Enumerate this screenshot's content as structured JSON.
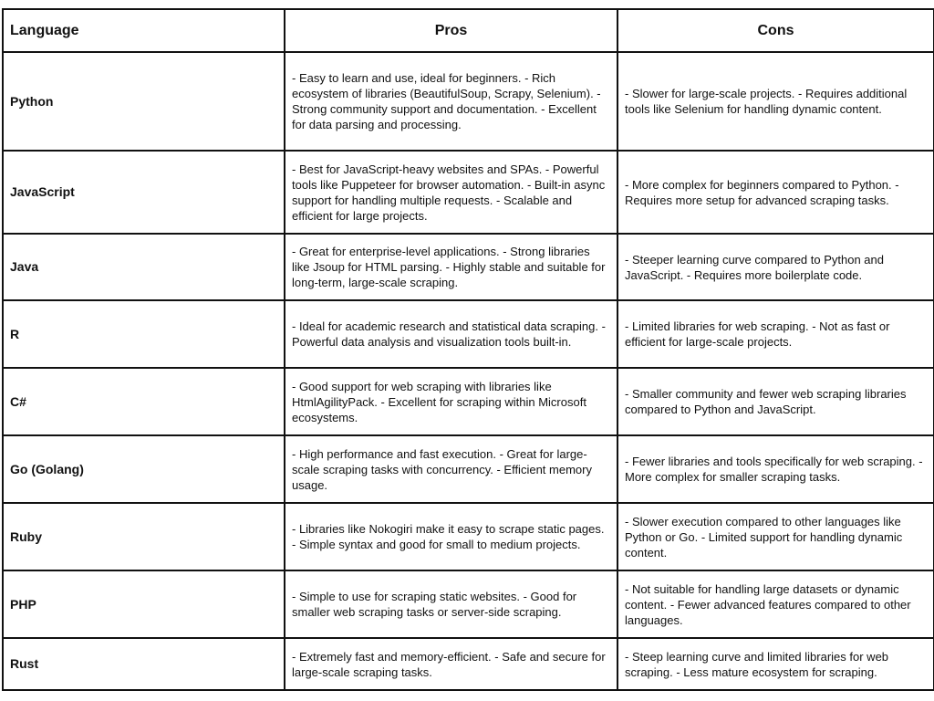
{
  "table": {
    "headers": {
      "language": "Language",
      "pros": "Pros",
      "cons": "Cons"
    },
    "rows": [
      {
        "language": "Python",
        "pros": "- Easy to learn and use, ideal for beginners.  - Rich ecosystem of libraries (BeautifulSoup, Scrapy, Selenium).  - Strong community support and documentation.  - Excellent for data parsing and processing.",
        "cons": "- Slower for large-scale projects.  - Requires additional tools like Selenium for handling dynamic content."
      },
      {
        "language": "JavaScript",
        "pros": "- Best for JavaScript-heavy websites and SPAs.  - Powerful tools like Puppeteer for browser automation.  - Built-in async support for handling multiple requests.  - Scalable and efficient for large projects.",
        "cons": "- More complex for beginners compared to Python.  - Requires more setup for advanced scraping tasks."
      },
      {
        "language": "Java",
        "pros": "- Great for enterprise-level applications.  - Strong libraries like Jsoup for HTML parsing.  - Highly stable and suitable for long-term, large-scale scraping.",
        "cons": "- Steeper learning curve compared to Python and JavaScript.  - Requires more boilerplate code."
      },
      {
        "language": "R",
        "pros": "- Ideal for academic research and statistical data scraping.  - Powerful data analysis and visualization tools built-in.",
        "cons": "- Limited libraries for web scraping.  - Not as fast or efficient for large-scale projects."
      },
      {
        "language": "C#",
        "pros": "- Good support for web scraping with libraries like HtmlAgilityPack.  - Excellent for scraping within Microsoft ecosystems.",
        "cons": "- Smaller community and fewer web scraping libraries compared to Python and JavaScript."
      },
      {
        "language": "Go (Golang)",
        "pros": "- High performance and fast execution.  - Great for large-scale scraping tasks with concurrency.  - Efficient memory usage.",
        "cons": "- Fewer libraries and tools specifically for web scraping.  - More complex for smaller scraping tasks."
      },
      {
        "language": "Ruby",
        "pros": "- Libraries like Nokogiri make it easy to scrape static pages.  - Simple syntax and good for small to medium projects.",
        "cons": "- Slower execution compared to other languages like Python or Go.  - Limited support for handling dynamic content."
      },
      {
        "language": "PHP",
        "pros": "- Simple to use for scraping static websites.  - Good for smaller web scraping tasks or server-side scraping.",
        "cons": "- Not suitable for handling large datasets or dynamic content.  - Fewer advanced features compared to other languages."
      },
      {
        "language": "Rust",
        "pros": "- Extremely fast and memory-efficient.  - Safe and secure for large-scale scraping tasks.",
        "cons": "- Steep learning curve and limited libraries for web scraping.  - Less mature ecosystem for scraping."
      }
    ]
  }
}
